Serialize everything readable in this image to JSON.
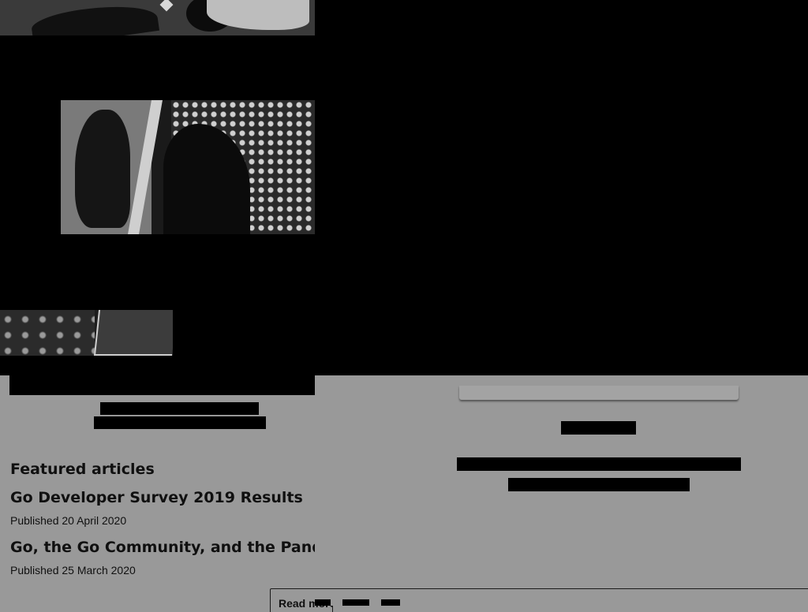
{
  "featured": {
    "heading": "Featured articles",
    "articles": [
      {
        "title": "Go Developer Survey 2019 Results",
        "date": "Published 20 April 2020"
      },
      {
        "title": "Go, the Go Community, and the Pandemic",
        "date": "Published 25 March 2020"
      }
    ]
  },
  "read_more_label": "Read more",
  "colors": {
    "page_background": "#999999",
    "hero_background": "#000000",
    "text": "#101010"
  }
}
